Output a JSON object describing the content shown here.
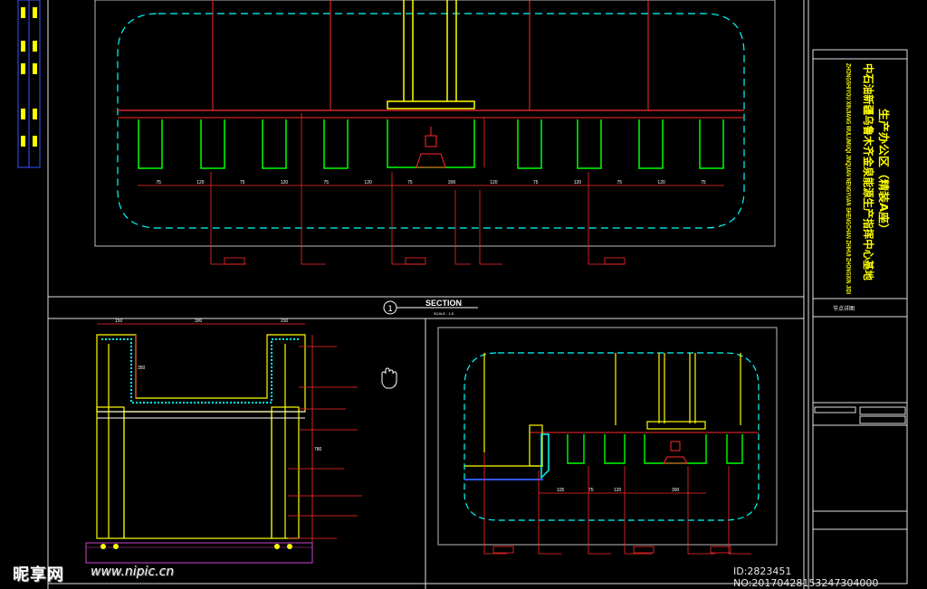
{
  "section_title": "SECTION",
  "section_scale": "SCALE : 1:5",
  "section_marker": "1",
  "watermark": {
    "site_name": "昵享网",
    "url": "www.nipic.cn",
    "image_id": "ID:2823451 NO:20170428153247304000"
  },
  "title_block": {
    "project_name_cn": "中石油新疆乌鲁木齐金泉能源生产指挥中心基地",
    "sub_title_cn": "生产办公区（精装A座）",
    "project_name_en": "ZHONGSHIYOU XINJIANG WULUMUQI JINQUAN NENGYUAN SHENGCHAN ZHIHUI ZHONGXIN JIDI",
    "drawing_name": "节点详图"
  },
  "top_dimensions": [
    "75",
    "120",
    "75",
    "120",
    "75",
    "120",
    "75",
    "300",
    "120",
    "75",
    "120",
    "75",
    "120",
    "75"
  ],
  "bottom_left_dimensions": {
    "top": [
      "150",
      "300",
      "150"
    ],
    "side": [
      "350",
      "780"
    ]
  },
  "bottom_right_dimensions": [
    "105",
    "75",
    "120",
    "300"
  ],
  "colors": {
    "frame": "#e0e0e0",
    "cyan": "#00ffff",
    "red": "#ff2a2a",
    "yellow": "#ffff00",
    "green": "#00ff00",
    "white": "#ffffff",
    "blue": "#3355ff"
  }
}
